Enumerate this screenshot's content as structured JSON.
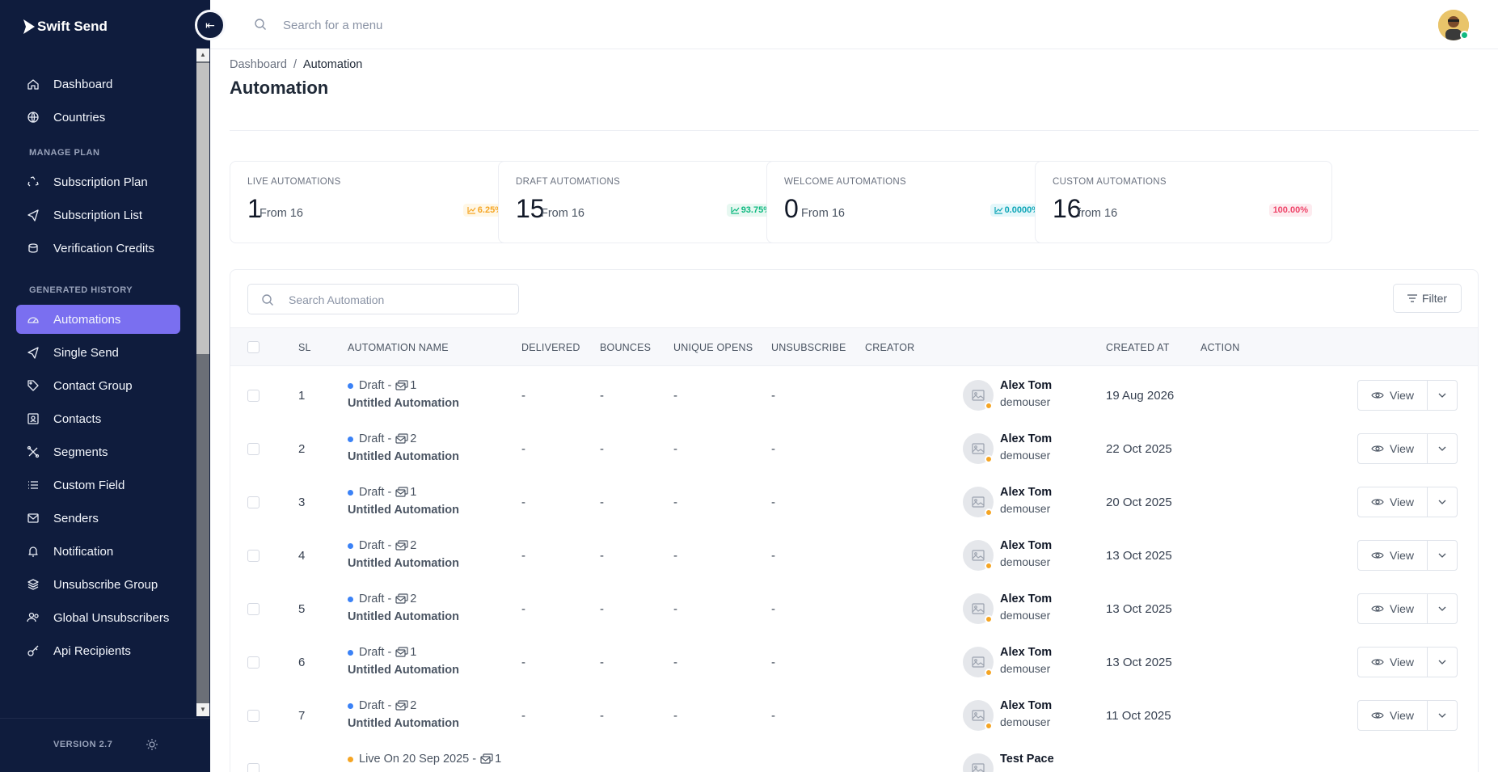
{
  "app": {
    "name": "Swift Send",
    "version": "VERSION 2.7"
  },
  "topbar": {
    "search_placeholder": "Search for a menu"
  },
  "sidebar": {
    "items_top": [
      {
        "label": "Dashboard",
        "icon": "home-icon"
      },
      {
        "label": "Countries",
        "icon": "globe-icon"
      }
    ],
    "section_plan": "MANAGE PLAN",
    "items_plan": [
      {
        "label": "Subscription Plan",
        "icon": "recycle-icon"
      },
      {
        "label": "Subscription List",
        "icon": "send-icon"
      },
      {
        "label": "Verification Credits",
        "icon": "coins-icon"
      }
    ],
    "section_history": "GENERATED HISTORY",
    "items_history": [
      {
        "label": "Automations",
        "icon": "gauge-icon",
        "active": true
      },
      {
        "label": "Single Send",
        "icon": "send-icon"
      },
      {
        "label": "Contact Group",
        "icon": "tag-icon"
      },
      {
        "label": "Contacts",
        "icon": "contact-icon"
      },
      {
        "label": "Segments",
        "icon": "segments-icon"
      },
      {
        "label": "Custom Field",
        "icon": "list-icon"
      },
      {
        "label": "Senders",
        "icon": "mail-icon"
      },
      {
        "label": "Notification",
        "icon": "bell-icon"
      },
      {
        "label": "Unsubscribe Group",
        "icon": "layers-icon"
      },
      {
        "label": "Global Unsubscribers",
        "icon": "users-icon"
      },
      {
        "label": "Api Recipients",
        "icon": "key-icon"
      }
    ]
  },
  "breadcrumb": {
    "root": "Dashboard",
    "sep": "/",
    "current": "Automation"
  },
  "page": {
    "title": "Automation"
  },
  "stats": [
    {
      "label": "LIVE AUTOMATIONS",
      "value": "1",
      "sub": "From 16",
      "badge": "6.25%",
      "badge_color": "#f5a524",
      "badge_bg": "#fff7e6"
    },
    {
      "label": "DRAFT AUTOMATIONS",
      "value": "15",
      "sub": "From 16",
      "badge": "93.75%",
      "badge_color": "#10b981",
      "badge_bg": "#e7f8f1"
    },
    {
      "label": "WELCOME AUTOMATIONS",
      "value": "0",
      "sub": "From 16",
      "badge": "0.0000%",
      "badge_color": "#0ea5b7",
      "badge_bg": "#e4f7fa"
    },
    {
      "label": "CUSTOM AUTOMATIONS",
      "value": "16",
      "sub": "from 16",
      "badge": "100.00%",
      "badge_color": "#ef4469",
      "badge_bg": "#fdebef"
    }
  ],
  "table": {
    "search_placeholder": "Search Automation",
    "filter_label": "Filter",
    "view_label": "View",
    "columns": [
      "SL",
      "AUTOMATION NAME",
      "DELIVERED",
      "BOUNCES",
      "UNIQUE OPENS",
      "UNSUBSCRIBE",
      "CREATOR",
      "CREATED AT",
      "ACTION"
    ],
    "rows": [
      {
        "sl": "1",
        "status": "Draft -",
        "steps": "1",
        "name": "Untitled Automation",
        "delivered": "-",
        "bounces": "-",
        "opens": "-",
        "unsub": "-",
        "creator": "Alex Tom",
        "user": "demouser",
        "created": "19 Aug 2026",
        "dot": "#3b82f6"
      },
      {
        "sl": "2",
        "status": "Draft -",
        "steps": "2",
        "name": "Untitled Automation",
        "delivered": "-",
        "bounces": "-",
        "opens": "-",
        "unsub": "-",
        "creator": "Alex Tom",
        "user": "demouser",
        "created": "22 Oct 2025",
        "dot": "#3b82f6"
      },
      {
        "sl": "3",
        "status": "Draft -",
        "steps": "1",
        "name": "Untitled Automation",
        "delivered": "-",
        "bounces": "-",
        "opens": "-",
        "unsub": "-",
        "creator": "Alex Tom",
        "user": "demouser",
        "created": "20 Oct 2025",
        "dot": "#3b82f6"
      },
      {
        "sl": "4",
        "status": "Draft -",
        "steps": "2",
        "name": "Untitled Automation",
        "delivered": "-",
        "bounces": "-",
        "opens": "-",
        "unsub": "-",
        "creator": "Alex Tom",
        "user": "demouser",
        "created": "13 Oct 2025",
        "dot": "#3b82f6"
      },
      {
        "sl": "5",
        "status": "Draft -",
        "steps": "2",
        "name": "Untitled Automation",
        "delivered": "-",
        "bounces": "-",
        "opens": "-",
        "unsub": "-",
        "creator": "Alex Tom",
        "user": "demouser",
        "created": "13 Oct 2025",
        "dot": "#3b82f6"
      },
      {
        "sl": "6",
        "status": "Draft -",
        "steps": "1",
        "name": "Untitled Automation",
        "delivered": "-",
        "bounces": "-",
        "opens": "-",
        "unsub": "-",
        "creator": "Alex Tom",
        "user": "demouser",
        "created": "13 Oct 2025",
        "dot": "#3b82f6"
      },
      {
        "sl": "7",
        "status": "Draft -",
        "steps": "2",
        "name": "Untitled Automation",
        "delivered": "-",
        "bounces": "-",
        "opens": "-",
        "unsub": "-",
        "creator": "Alex Tom",
        "user": "demouser",
        "created": "11 Oct 2025",
        "dot": "#3b82f6"
      },
      {
        "sl": "",
        "status": "Live On 20 Sep 2025 -",
        "steps": "1",
        "name": "",
        "delivered": "",
        "bounces": "",
        "opens": "",
        "unsub": "",
        "creator": "Test Pace",
        "user": "",
        "created": "",
        "dot": "#f5a524"
      }
    ]
  }
}
